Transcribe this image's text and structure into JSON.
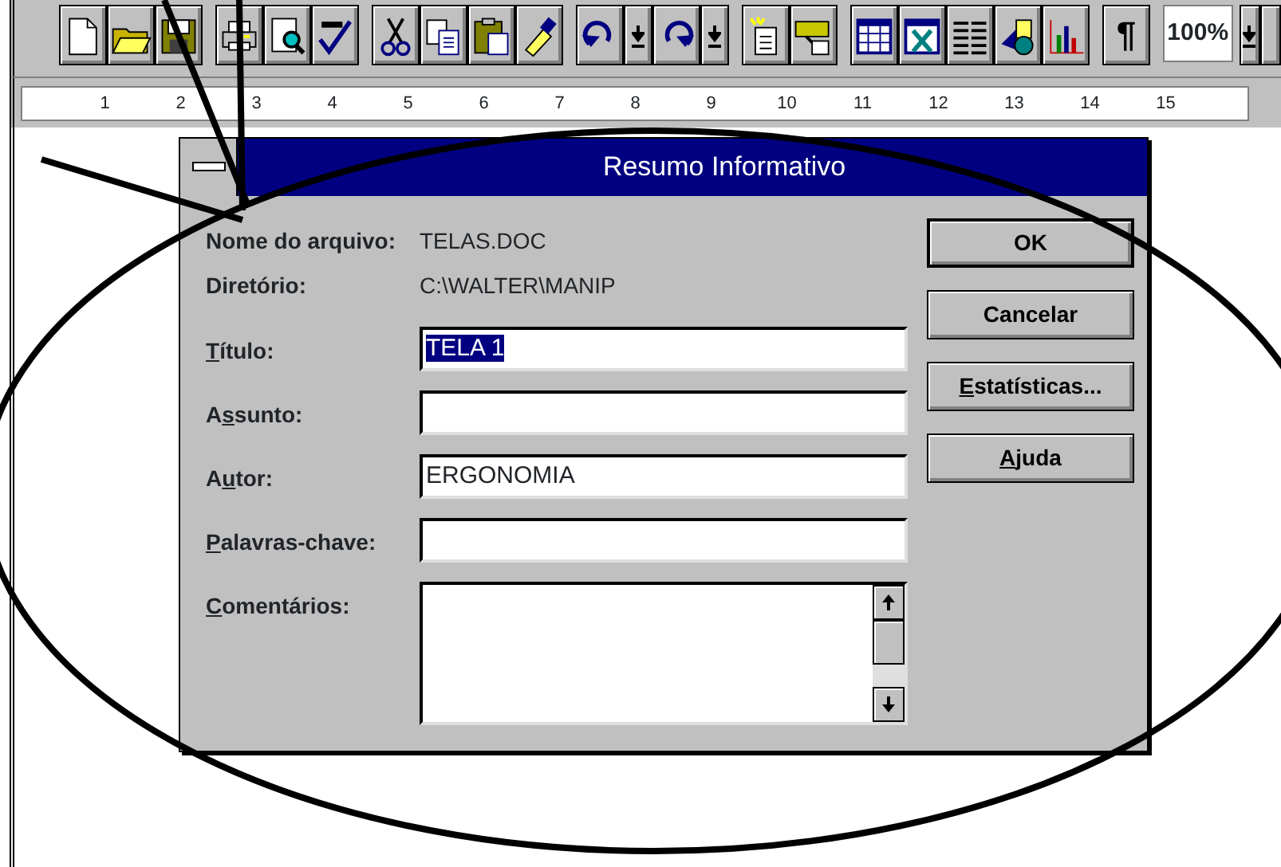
{
  "toolbar": {
    "pilcrow": "¶",
    "zoom_value": "100%"
  },
  "ruler": {
    "marks": [
      "1",
      "2",
      "3",
      "4",
      "5",
      "6",
      "7",
      "8",
      "9",
      "10",
      "11",
      "12",
      "13",
      "14",
      "15"
    ]
  },
  "dialog": {
    "title": "Resumo Informativo",
    "info": [
      {
        "label": "Nome do arquivo:",
        "value": "TELAS.DOC"
      },
      {
        "label": "Diretório:",
        "value": "C:\\WALTER\\MANIP"
      }
    ],
    "fields": [
      {
        "kind": "line",
        "label_key": "T",
        "label_after": "ítulo:",
        "value": "TELA 1",
        "selected_text": true
      },
      {
        "kind": "line",
        "label_before": "A",
        "label_key": "s",
        "label_after": "sunto:"
      },
      {
        "kind": "line",
        "label_before": "A",
        "label_key": "u",
        "label_after": "tor:",
        "value": "ERGONOMIA"
      },
      {
        "kind": "line",
        "label_key": "P",
        "label_after": "alavras-chave:"
      },
      {
        "kind": "area",
        "label_key": "C",
        "label_after": "omentários:"
      }
    ],
    "buttons": [
      {
        "after": "OK",
        "default": true
      },
      {
        "after": "Cancelar",
        "default": false
      },
      {
        "key": "E",
        "after": "statísticas...",
        "default": false
      },
      {
        "key": "A",
        "after": "juda",
        "default": false
      }
    ]
  }
}
